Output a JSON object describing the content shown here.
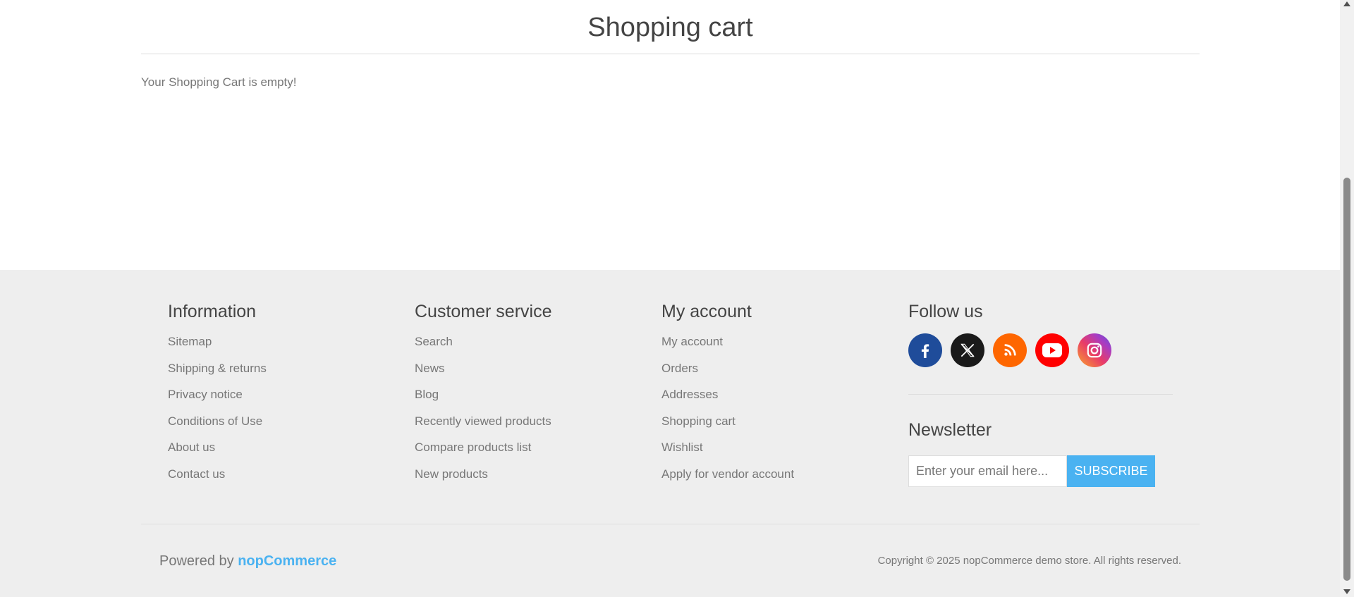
{
  "main": {
    "title": "Shopping cart",
    "empty_message": "Your Shopping Cart is empty!"
  },
  "footer": {
    "information": {
      "heading": "Information",
      "links": [
        "Sitemap",
        "Shipping & returns",
        "Privacy notice",
        "Conditions of Use",
        "About us",
        "Contact us"
      ]
    },
    "customer_service": {
      "heading": "Customer service",
      "links": [
        "Search",
        "News",
        "Blog",
        "Recently viewed products",
        "Compare products list",
        "New products"
      ]
    },
    "my_account": {
      "heading": "My account",
      "links": [
        "My account",
        "Orders",
        "Addresses",
        "Shopping cart",
        "Wishlist",
        "Apply for vendor account"
      ]
    },
    "follow_us": {
      "heading": "Follow us",
      "social": [
        "facebook-icon",
        "x-twitter-icon",
        "rss-icon",
        "youtube-icon",
        "instagram-icon"
      ]
    },
    "newsletter": {
      "heading": "Newsletter",
      "placeholder": "Enter your email here...",
      "button_label": "SUBSCRIBE"
    },
    "powered_by_prefix": "Powered by",
    "powered_by_brand": "nopCommerce",
    "copyright": "Copyright © 2025 nopCommerce demo store. All rights reserved."
  },
  "colors": {
    "accent": "#4ab2f1",
    "footer_bg": "#eeeeee",
    "text": "#444444",
    "muted_text": "#777777"
  }
}
